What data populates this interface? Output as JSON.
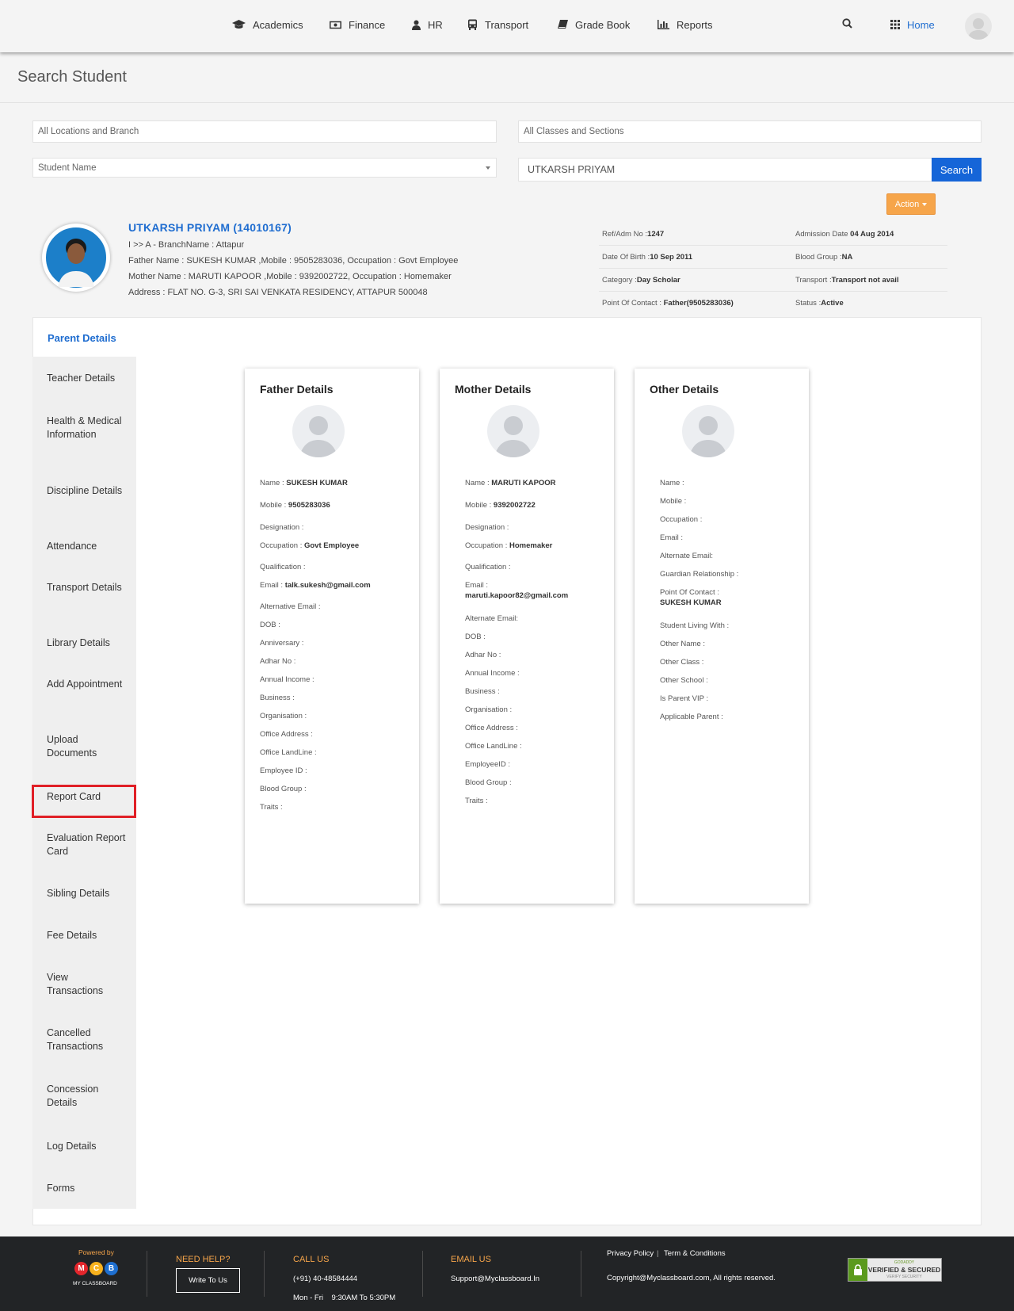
{
  "nav": {
    "items": [
      "Academics",
      "Finance",
      "HR",
      "Transport",
      "Grade Book",
      "Reports"
    ],
    "home": "Home"
  },
  "page": {
    "title": "Search Student"
  },
  "filters": {
    "location": "All Locations and Branch",
    "classes": "All Classes and Sections",
    "search_by": "Student Name",
    "query": "UTKARSH PRIYAM",
    "search_button": "Search",
    "action_button": "Action"
  },
  "student": {
    "name": "UTKARSH PRIYAM (14010167)",
    "class_line": "I >> A - BranchName : Attapur",
    "father_line": "Father Name : SUKESH KUMAR ,Mobile : 9505283036, Occupation : Govt Employee",
    "mother_line": "Mother Name : MARUTI KAPOOR ,Mobile : 9392002722, Occupation : Homemaker",
    "address_line": "Address : FLAT NO. G-3, SRI SAI VENKATA RESIDENCY, ATTAPUR 500048",
    "info": [
      {
        "l1": "Ref/Adm No :",
        "v1": "1247",
        "l2": "Admission Date ",
        "v2": "04 Aug 2014"
      },
      {
        "l1": "Date Of Birth :",
        "v1": "10 Sep 2011",
        "l2": "Blood Group :",
        "v2": "NA"
      },
      {
        "l1": "Category :",
        "v1": "Day Scholar",
        "l2": "Transport :",
        "v2": "Transport not avail"
      },
      {
        "l1": "Point Of Contact : ",
        "v1": "Father(9505283036)",
        "l2": "Status :",
        "v2": "Active"
      }
    ]
  },
  "tabs": {
    "active": "Parent Details",
    "items": [
      "Teacher Details",
      "Health & Medical Information",
      "Discipline Details",
      "Attendance",
      "Transport Details",
      "Library Details",
      "Add Appointment",
      "Upload Documents",
      "Report Card",
      "Evaluation Report Card",
      "Sibling Details",
      "Fee Details",
      "View Transactions",
      "Cancelled Transactions",
      "Concession Details",
      "Log Details",
      "Forms"
    ]
  },
  "father": {
    "title": "Father Details",
    "fields": [
      {
        "label": "Name : ",
        "value": "SUKESH KUMAR"
      },
      {
        "label": "Mobile : ",
        "value": "9505283036"
      },
      {
        "label": "Designation : ",
        "value": ""
      },
      {
        "label": "Occupation : ",
        "value": "Govt Employee"
      },
      {
        "label": "Qualification : ",
        "value": ""
      },
      {
        "label": "Email : ",
        "value": "talk.sukesh@gmail.com"
      },
      {
        "label": "Alternative Email : ",
        "value": ""
      },
      {
        "label": "DOB : ",
        "value": ""
      },
      {
        "label": "Anniversary : ",
        "value": ""
      },
      {
        "label": "Adhar No : ",
        "value": ""
      },
      {
        "label": "Annual Income : ",
        "value": ""
      },
      {
        "label": "Business : ",
        "value": ""
      },
      {
        "label": "Organisation : ",
        "value": ""
      },
      {
        "label": "Office Address : ",
        "value": ""
      },
      {
        "label": "Office LandLine : ",
        "value": ""
      },
      {
        "label": "Employee ID : ",
        "value": ""
      },
      {
        "label": "Blood Group : ",
        "value": ""
      },
      {
        "label": "Traits : ",
        "value": ""
      }
    ]
  },
  "mother": {
    "title": "Mother Details",
    "fields": [
      {
        "label": "Name : ",
        "value": "MARUTI KAPOOR"
      },
      {
        "label": "Mobile : ",
        "value": "9392002722"
      },
      {
        "label": "Designation : ",
        "value": ""
      },
      {
        "label": "Occupation : ",
        "value": "Homemaker"
      },
      {
        "label": "Qualification : ",
        "value": ""
      },
      {
        "label": "Email : ",
        "value": "maruti.kapoor82@gmail.com"
      },
      {
        "label": "Alternate Email: ",
        "value": ""
      },
      {
        "label": "DOB : ",
        "value": ""
      },
      {
        "label": "Adhar No : ",
        "value": ""
      },
      {
        "label": "Annual Income : ",
        "value": ""
      },
      {
        "label": "Business : ",
        "value": ""
      },
      {
        "label": "Organisation : ",
        "value": ""
      },
      {
        "label": "Office Address : ",
        "value": ""
      },
      {
        "label": "Office LandLine : ",
        "value": ""
      },
      {
        "label": "EmployeeID : ",
        "value": ""
      },
      {
        "label": "Blood Group : ",
        "value": ""
      },
      {
        "label": "Traits : ",
        "value": ""
      }
    ]
  },
  "other": {
    "title": "Other Details",
    "fields": [
      {
        "label": "Name : ",
        "value": ""
      },
      {
        "label": "Mobile : ",
        "value": ""
      },
      {
        "label": "Occupation : ",
        "value": ""
      },
      {
        "label": "Email : ",
        "value": ""
      },
      {
        "label": "Alternate Email: ",
        "value": ""
      },
      {
        "label": "Guardian Relationship : ",
        "value": ""
      },
      {
        "label": "Point Of Contact : ",
        "value": "SUKESH KUMAR"
      },
      {
        "label": "Student Living With : ",
        "value": ""
      },
      {
        "label": "Other Name : ",
        "value": ""
      },
      {
        "label": "Other Class : ",
        "value": ""
      },
      {
        "label": "Other School : ",
        "value": ""
      },
      {
        "label": "Is Parent VIP : ",
        "value": ""
      },
      {
        "label": "Applicable Parent : ",
        "value": ""
      }
    ]
  },
  "footer": {
    "powered_by": "Powered by",
    "logo_letters": [
      "M",
      "C",
      "B"
    ],
    "logo_text": "MY CLASSBOARD",
    "need_help": "NEED HELP?",
    "write_to_us": "Write To Us",
    "call_us": "CALL US",
    "phone": "(+91) 40-48584444",
    "hours": "Mon - Fri    9:30AM To 5:30PM",
    "email_us": "EMAIL US",
    "email": "Support@Myclassboard.In",
    "privacy": "Privacy Policy",
    "terms": "Term & Conditions",
    "copyright": "Copyright@Myclassboard.com, All rights reserved.",
    "badge_top": "GODADDY",
    "badge_main": "VERIFIED & SECURED",
    "badge_sub": "VERIFY SECURITY"
  },
  "colors": {
    "accent": "#1f6dd0",
    "search_button": "#1565d8",
    "action_button": "#f6a54a",
    "highlight": "#e01f26",
    "footer_bg": "#222426"
  }
}
